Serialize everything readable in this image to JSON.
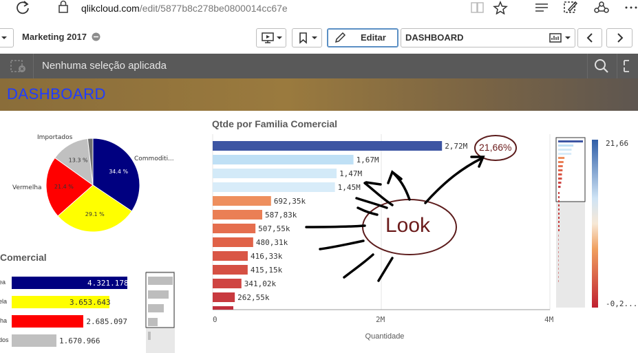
{
  "browser": {
    "url": "qlikcloud.com/edit/5877b8c278be0800014cc67e",
    "url_domain": "qlikcloud.com",
    "url_path": "/edit/5877b8c278be0800014cc67e"
  },
  "toolbar": {
    "app_title": "Marketing 2017",
    "edit_label": "Editar",
    "sheet_name": "DASHBOARD"
  },
  "selections": {
    "text": "Nenhuma seleção aplicada"
  },
  "sheet": {
    "title": "DASHBOARD"
  },
  "pie": {
    "slices": [
      {
        "label": "Commoditi...",
        "pct_label": "34.4 %",
        "value": 34.4,
        "color": "#000080"
      },
      {
        "label": "",
        "pct_label": "29.1 %",
        "value": 29.1,
        "color": "#ffff00"
      },
      {
        "label": "Vermelha",
        "pct_label": "21.4 %",
        "value": 21.4,
        "color": "#ff0000"
      },
      {
        "label": "Importados",
        "pct_label": "13.3 %",
        "value": 13.3,
        "color": "#c0c0c0"
      },
      {
        "label": "",
        "pct_label": "",
        "value": 1.8,
        "color": "#707070"
      }
    ]
  },
  "left_bar": {
    "title": "Comercial",
    "rows": [
      {
        "label": "ea",
        "value_label": "4.321.178",
        "value": 4321178,
        "color": "#000080",
        "label_color": "#ffffff"
      },
      {
        "label": "ela",
        "value_label": "3.653.643",
        "value": 3653643,
        "color": "#ffff00",
        "label_color": "#333333"
      },
      {
        "label": "lha",
        "value_label": "2.685.097",
        "value": 2685097,
        "color": "#ff0000",
        "label_color": "#333333"
      },
      {
        "label": "dos",
        "value_label": "1.670.966",
        "value": 1670966,
        "color": "#c0c0c0",
        "label_color": "#333333"
      }
    ]
  },
  "chart_data": {
    "type": "bar",
    "title": "Qtde por Familia Comercial",
    "xlabel": "Quantidade",
    "ylabel": "",
    "xlim": [
      0,
      4000000
    ],
    "ticks": [
      "0",
      "2M",
      "4M"
    ],
    "tick_values": [
      0,
      2000000,
      4000000
    ],
    "values": [
      2720000,
      1670000,
      1470000,
      1450000,
      692350,
      587830,
      507550,
      480310,
      416330,
      415150,
      341020,
      262550
    ],
    "value_labels": [
      "2,72M",
      "1,67M",
      "1,47M",
      "1,45M",
      "692,35k",
      "587,83k",
      "507,55k",
      "480,31k",
      "416,33k",
      "415,15k",
      "341,02k",
      "262,55k"
    ],
    "colors": [
      "#3d55a3",
      "#bfe0f5",
      "#d3eaf8",
      "#d8ecf9",
      "#ee8f5e",
      "#ea7f55",
      "#e56e4e",
      "#e06248",
      "#d95646",
      "#d55043",
      "#cf4542",
      "#c83a3f"
    ],
    "legend_scale": {
      "max_label": "21,66",
      "min_label": "-0,2...",
      "top_color": "#2f5ea8",
      "bottom_color": "#c02030"
    }
  },
  "annotation": {
    "look_text": "Look",
    "pct_text": "21,66%"
  }
}
